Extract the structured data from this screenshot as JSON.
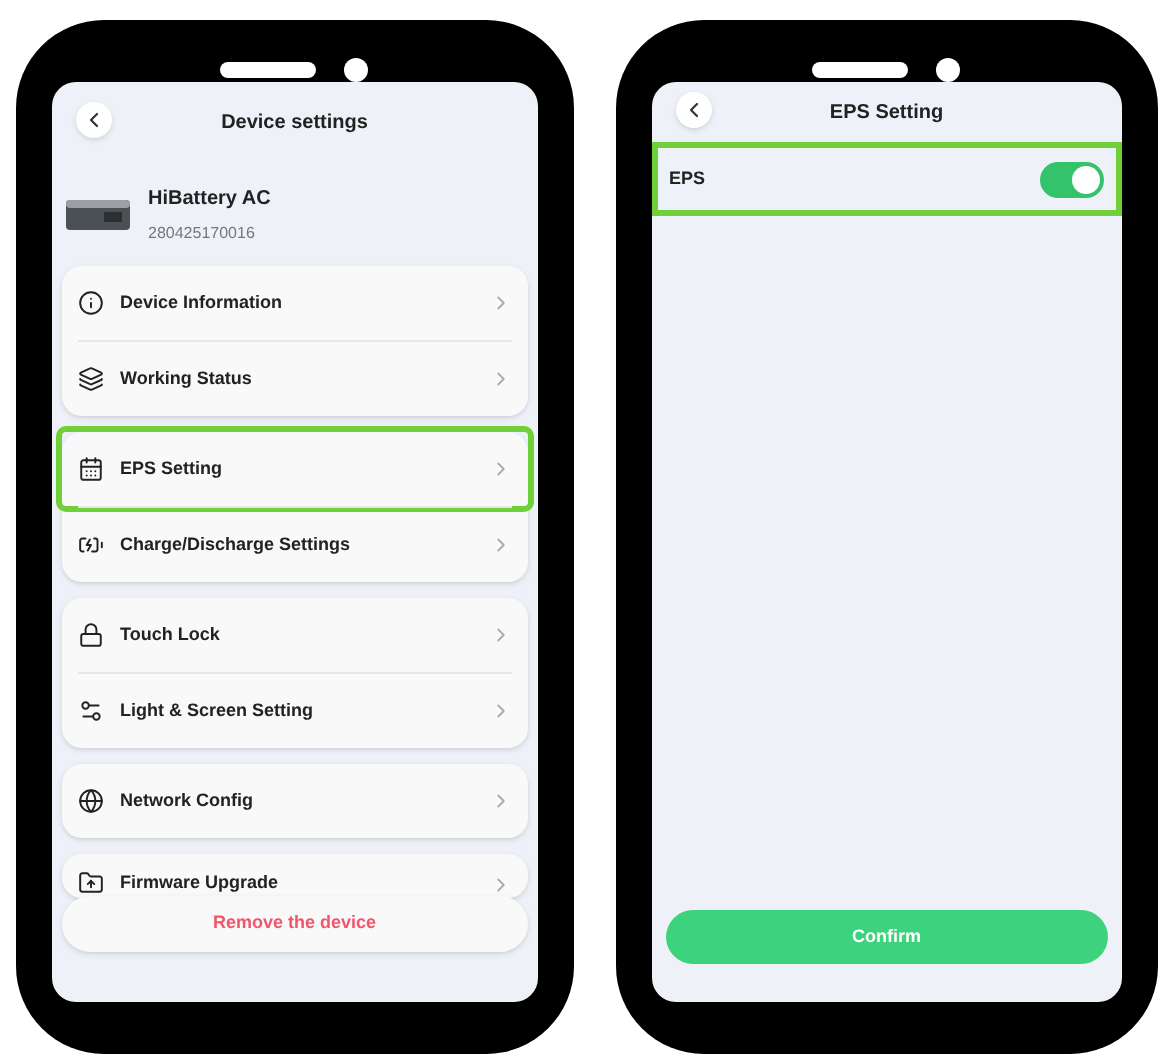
{
  "device_settings": {
    "title": "Device settings",
    "device": {
      "name": "HiBattery AC",
      "serial": "280425170016"
    },
    "groups": [
      {
        "items": [
          {
            "label": "Device Information",
            "highlighted": false
          },
          {
            "label": "Working Status",
            "highlighted": false
          }
        ]
      },
      {
        "items": [
          {
            "label": "EPS Setting",
            "highlighted": true
          },
          {
            "label": "Charge/Discharge Settings",
            "highlighted": false
          }
        ]
      },
      {
        "items": [
          {
            "label": "Touch Lock",
            "highlighted": false
          },
          {
            "label": "Light & Screen Setting",
            "highlighted": false
          }
        ]
      },
      {
        "items": [
          {
            "label": "Network Config",
            "highlighted": false
          }
        ]
      },
      {
        "items": [
          {
            "label": "Firmware Upgrade",
            "highlighted": false
          }
        ]
      }
    ],
    "remove_button": "Remove the device"
  },
  "eps_setting": {
    "title": "EPS Setting",
    "row": {
      "label": "EPS",
      "on": true,
      "highlighted": true
    },
    "confirm_button": "Confirm"
  }
}
